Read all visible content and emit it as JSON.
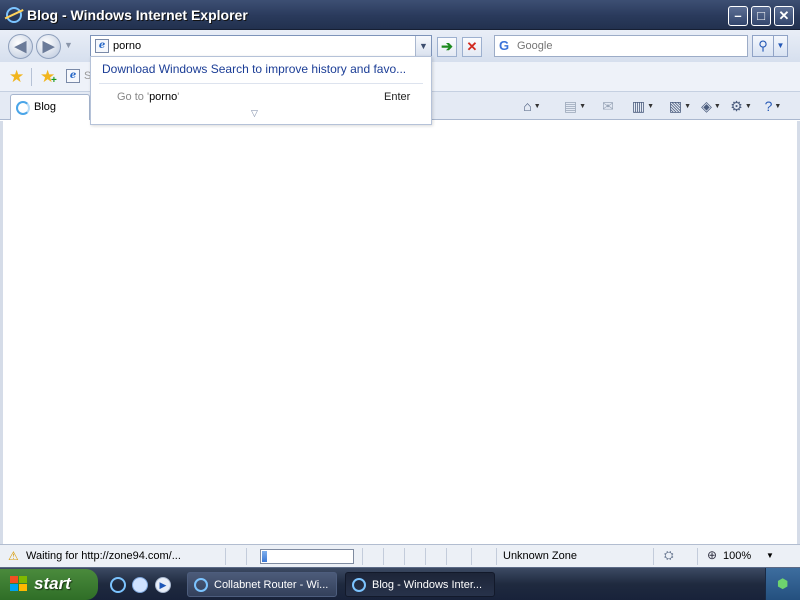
{
  "window": {
    "title": "Blog - Windows Internet Explorer",
    "min": "–",
    "max": "□",
    "close": "✕"
  },
  "nav": {
    "back": "◀",
    "forward": "▶",
    "history_dd": "▼"
  },
  "address": {
    "value": "porno",
    "page_icon": "e",
    "dd": "▼"
  },
  "go": "➔",
  "stop": "✕",
  "search": {
    "placeholder": "Google",
    "logo": "G",
    "go_icon": "⚲",
    "dd": "▼"
  },
  "favorites_bar": {
    "favorites_icon": "★",
    "add_icon": "★",
    "add_plus": "+",
    "page_icon": "e",
    "suggested_label": "S"
  },
  "tab": {
    "label": "Blog"
  },
  "commands": {
    "home": "⌂",
    "feeds": "▤",
    "mail": "✉",
    "print": "▥",
    "page": "▧",
    "safety": "◈",
    "tools": "⚙",
    "help": "?",
    "arrow": "▼"
  },
  "autocomplete": {
    "windows_search": "Download Windows Search to improve history and favo...",
    "goto_prefix": "Go to '",
    "goto_query": "porno",
    "goto_suffix": "'",
    "enter_hint": "Enter",
    "expand": "▽"
  },
  "status": {
    "warn_icon": "⚠",
    "text": "Waiting for http://zone94.com/...",
    "progress": 0.06,
    "zone": "Unknown Zone",
    "protect_icon": "⛭",
    "zoom_icon": "⊕",
    "zoom": "100%",
    "zoom_dd": "▼"
  },
  "taskbar": {
    "start": "start",
    "media_icon": "▶",
    "tasks": [
      {
        "label": "Collabnet Router - Wi..."
      },
      {
        "label": "Blog - Windows Inter..."
      }
    ],
    "tray_icon": "⬢"
  }
}
